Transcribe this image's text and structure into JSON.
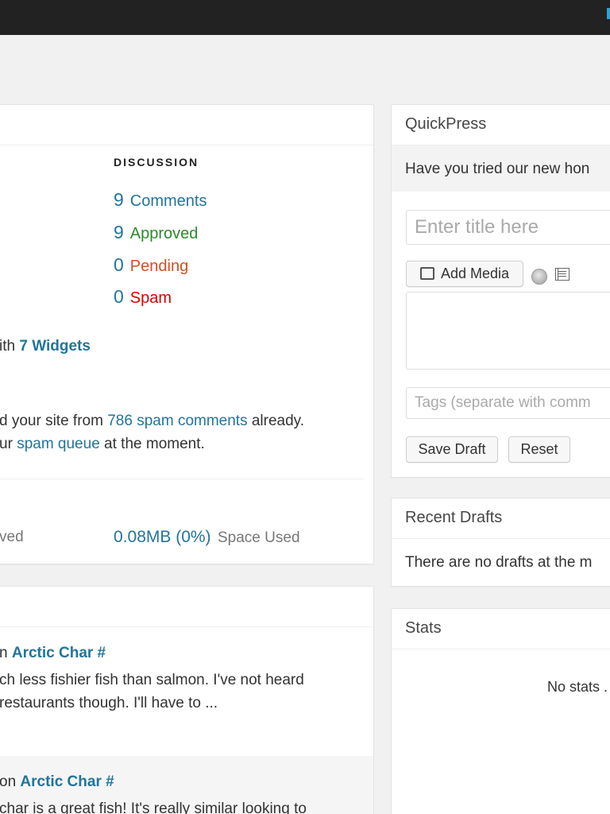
{
  "colors": {
    "link": "#21759b",
    "approved": "#2d8a2d",
    "pending": "#d54e21",
    "spam": "#dd0000",
    "topbar": "#222222"
  },
  "right_now": {
    "discussion_heading": "DISCUSSION",
    "discussion": [
      {
        "count": "9",
        "label": "Comments"
      },
      {
        "count": "9",
        "label": "Approved"
      },
      {
        "count": "0",
        "label": "Pending"
      },
      {
        "count": "0",
        "label": "Spam"
      }
    ],
    "theme_prefix": "ith ",
    "theme_widgets_link": "7 Widgets",
    "akismet_line1_prefix": "d your site from ",
    "akismet_spam_link": "786 spam comments",
    "akismet_line1_suffix": " already.",
    "akismet_line2_prefix": "ur ",
    "akismet_queue_link": "spam queue",
    "akismet_line2_suffix": " at the moment.",
    "storage_left": "ved",
    "space_value": "0.08MB (0%)",
    "space_label": "Space Used"
  },
  "recent_comments": [
    {
      "prefix": "n ",
      "post_link": "Arctic Char #",
      "line1": "ch less fishier fish than salmon. I've not heard",
      "line2": "restaurants though. I'll have to ..."
    },
    {
      "prefix": " on ",
      "post_link": "Arctic Char #",
      "line1": " char is a great fish! It's really similar looking to"
    }
  ],
  "quickpress": {
    "title": "QuickPress",
    "notice": "Have you tried our new hon",
    "title_placeholder": "Enter title here",
    "add_media_label": "Add Media",
    "tags_placeholder": "Tags (separate with comm",
    "save_draft_label": "Save Draft",
    "reset_label": "Reset"
  },
  "recent_drafts": {
    "title": "Recent Drafts",
    "message": "There are no drafts at the m"
  },
  "stats": {
    "title": "Stats",
    "message": "No stats ."
  }
}
